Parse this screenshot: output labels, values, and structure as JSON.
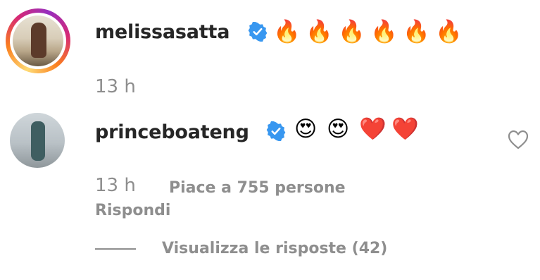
{
  "comments": [
    {
      "username": "melissasatta",
      "verified": true,
      "emoji": [
        "🔥",
        "🔥",
        "🔥",
        "🔥",
        "🔥",
        "🔥"
      ],
      "time": "13 h",
      "has_story_ring": true
    },
    {
      "username": "princeboateng",
      "verified": true,
      "emoji": [
        "😍",
        "😍",
        "❤️",
        "❤️"
      ],
      "time": "13 h",
      "likes_text": "Piace a 755 persone",
      "reply_label": "Rispondi",
      "view_replies_label": "Visualizza le risposte (42)"
    }
  ],
  "colors": {
    "verified_blue": "#3897f0",
    "secondary_text": "#8e8e8e",
    "primary_text": "#262626"
  },
  "icons": {
    "verified": "verified-badge-icon",
    "like": "heart-outline-icon"
  }
}
